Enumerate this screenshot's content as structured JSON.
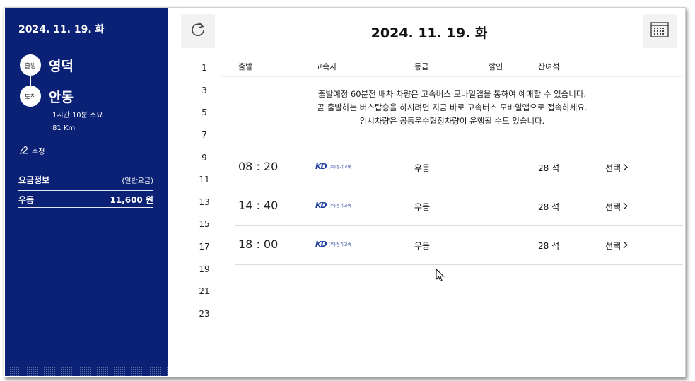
{
  "sidebar": {
    "date": "2024. 11. 19. 화",
    "departure_badge": "출발",
    "departure_city": "영덕",
    "arrival_badge": "도착",
    "arrival_city": "안동",
    "duration": "1시간 10분 소요",
    "distance": "81 Km",
    "edit_label": "수정",
    "fare_title": "요금정보",
    "fare_type": "(일반요금)",
    "fare_grade": "우등",
    "fare_amount": "11,600 원"
  },
  "header": {
    "date": "2024. 11. 19. 화"
  },
  "hours": [
    "1",
    "3",
    "5",
    "7",
    "9",
    "11",
    "13",
    "15",
    "17",
    "19",
    "21",
    "23"
  ],
  "columns": {
    "departure": "출발",
    "company": "고속사",
    "grade": "등급",
    "discount": "할인",
    "seats": "잔여석"
  },
  "notice": {
    "line1": "출발예정 60분전 배차 차량은 고속버스 모바일앱을 통하여 예매할 수 있습니다.",
    "line2": "곧 출발하는 버스탑승을 하시려면 지금 바로 고속버스 모바일앱으로 접속하세요.",
    "line3": "임시차량은 공동운수협정차량이 운행될 수도 있습니다."
  },
  "schedules": [
    {
      "time": "08 : 20",
      "company_logo": "KD",
      "company_name": "(주)경기고속",
      "grade": "우등",
      "seats": "28 석",
      "select": "선택"
    },
    {
      "time": "14 : 40",
      "company_logo": "KD",
      "company_name": "(주)경기고속",
      "grade": "우등",
      "seats": "28 석",
      "select": "선택"
    },
    {
      "time": "18 : 00",
      "company_logo": "KD",
      "company_name": "(주)경기고속",
      "grade": "우등",
      "seats": "28 석",
      "select": "선택"
    }
  ],
  "icons": {
    "refresh": "refresh-icon",
    "calendar": "calendar-icon",
    "edit": "edit-icon",
    "chevron": "chevron-right-icon"
  },
  "colors": {
    "sidebar_bg": "#0b2176",
    "logo_blue": "#1b3c9a",
    "logo_red": "#e0242a"
  }
}
